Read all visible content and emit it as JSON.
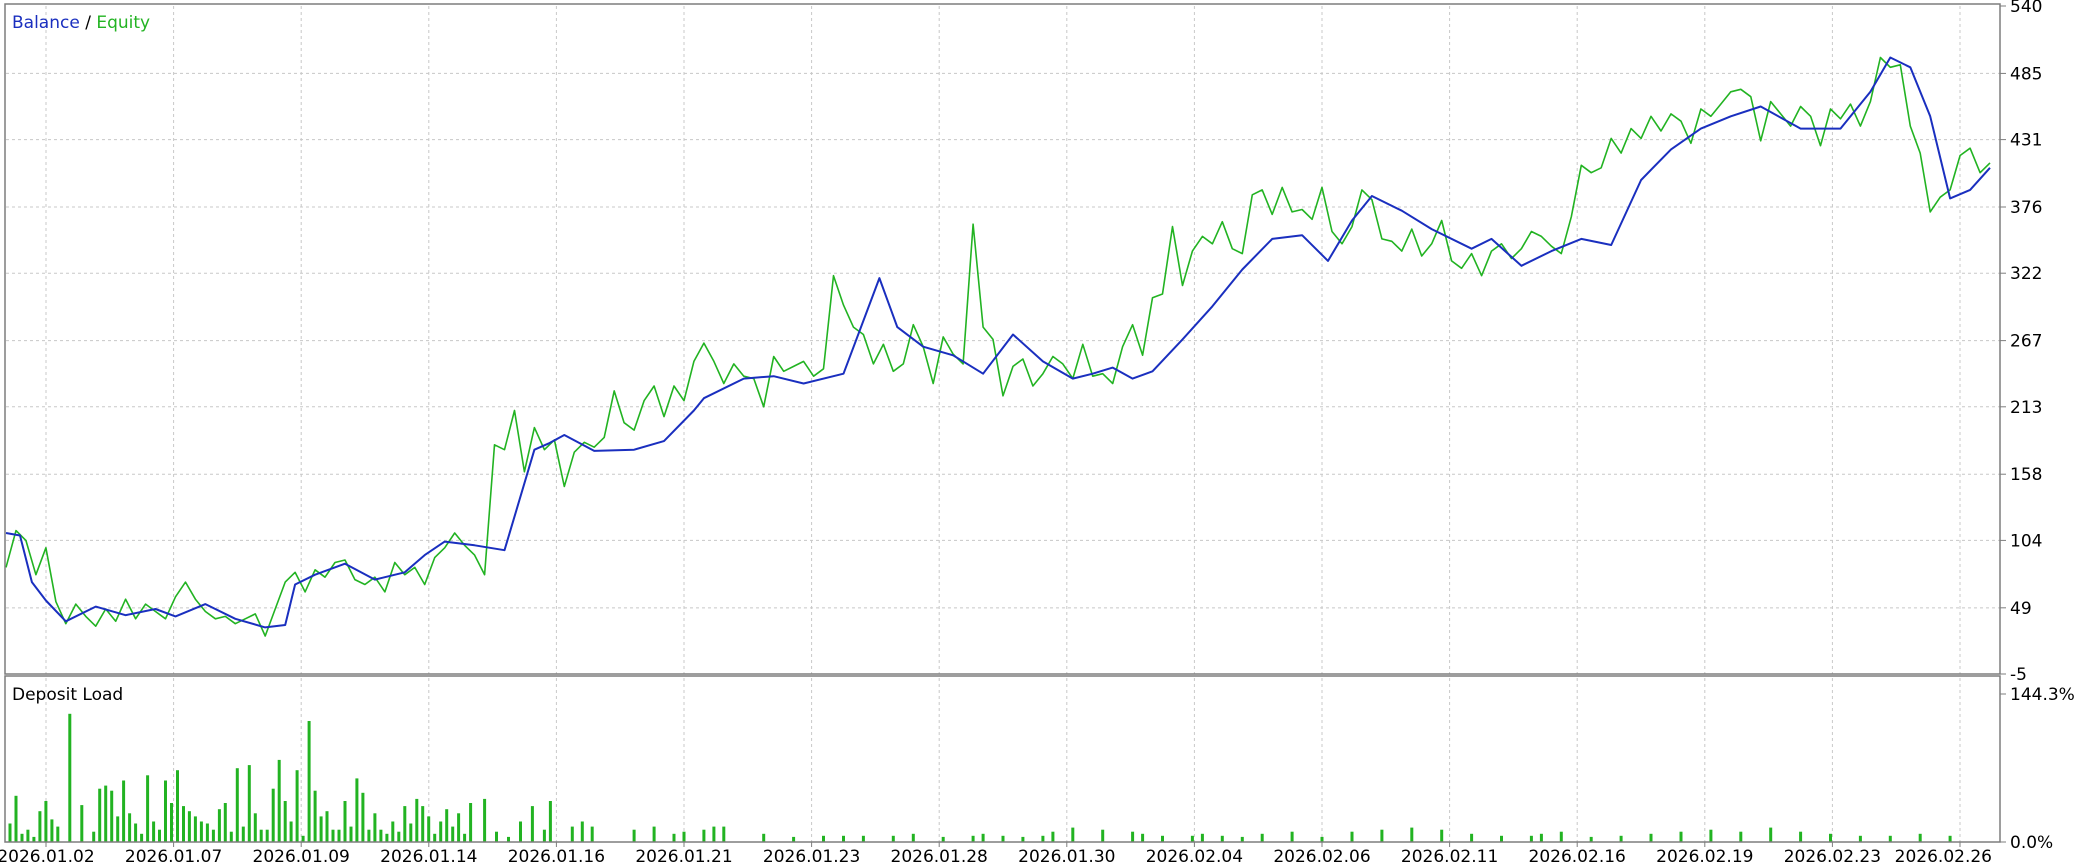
{
  "colors": {
    "balance": "#1a2fbf",
    "equity": "#22b322",
    "grid": "#c8c8c8",
    "frame": "#7d7d7d",
    "text": "#000000",
    "background": "#ffffff",
    "deposit_bars": "#22b322"
  },
  "chart_data": [
    {
      "type": "line",
      "legend": {
        "placement": "top-left",
        "entries": [
          "Balance",
          "Equity"
        ],
        "separator": " / "
      },
      "y_ticks": [
        "540",
        "485",
        "431",
        "376",
        "322",
        "267",
        "213",
        "158",
        "104",
        "49",
        "-5"
      ],
      "ylim": [
        -5,
        540
      ],
      "grid": true,
      "x_tick_labels": [
        "2026.01.02",
        "2026.01.07",
        "2026.01.09",
        "2026.01.14",
        "2026.01.16",
        "2026.01.21",
        "2026.01.23",
        "2026.01.28",
        "2026.01.30",
        "2026.02.04",
        "2026.02.06",
        "2026.02.11",
        "2026.02.16",
        "2026.02.19",
        "2026.02.23",
        "2026.02.26"
      ],
      "x_range": [
        0,
        100
      ],
      "series": [
        {
          "name": "Balance",
          "x": [
            0,
            0.7,
            1.3,
            2,
            3,
            4.5,
            6,
            7.5,
            8.5,
            10,
            11.5,
            13,
            14,
            14.5,
            15.5,
            17,
            18.5,
            20,
            21,
            22,
            23.5,
            25,
            26.5,
            27.2,
            28,
            29.5,
            31.5,
            33,
            34.5,
            35,
            37,
            38.5,
            40,
            42,
            43.8,
            44.7,
            46,
            47.5,
            49,
            50.5,
            52,
            53.5,
            54.5,
            55.5,
            56.5,
            57.5,
            59,
            60.5,
            62,
            63.5,
            65,
            66.3,
            67.5,
            68.5,
            70,
            71.5,
            73.5,
            74.5,
            76,
            77.5,
            79,
            80.5,
            82,
            83.5,
            85,
            86.5,
            88,
            90,
            92,
            93.5,
            94.5,
            95.5,
            96.5,
            97.5,
            98.5,
            99.5
          ],
          "y": [
            110,
            108,
            70,
            55,
            38,
            50,
            43,
            48,
            42,
            52,
            40,
            33,
            35,
            68,
            76,
            85,
            72,
            78,
            92,
            103,
            100,
            96,
            178,
            183,
            190,
            177,
            178,
            185,
            210,
            220,
            236,
            238,
            232,
            240,
            318,
            278,
            262,
            255,
            240,
            272,
            250,
            236,
            240,
            245,
            236,
            242,
            268,
            295,
            325,
            350,
            353,
            332,
            365,
            385,
            373,
            358,
            342,
            350,
            328,
            340,
            350,
            345,
            398,
            423,
            440,
            450,
            458,
            440,
            440,
            470,
            498,
            490,
            450,
            383,
            390,
            408
          ]
        },
        {
          "name": "Equity",
          "x": [
            0,
            0.5,
            1,
            1.5,
            2,
            2.5,
            3,
            3.5,
            4,
            4.5,
            5,
            5.5,
            6,
            6.5,
            7,
            7.5,
            8,
            8.5,
            9,
            9.5,
            10,
            10.5,
            11,
            11.5,
            12,
            12.5,
            13,
            13.5,
            14,
            14.5,
            15,
            15.5,
            16,
            16.5,
            17,
            17.5,
            18,
            18.5,
            19,
            19.5,
            20,
            20.5,
            21,
            21.5,
            22,
            22.5,
            23,
            23.5,
            24,
            24.5,
            25,
            25.5,
            26,
            26.5,
            27,
            27.5,
            28,
            28.5,
            29,
            29.5,
            30,
            30.5,
            31,
            31.5,
            32,
            32.5,
            33,
            33.5,
            34,
            34.5,
            35,
            35.5,
            36,
            36.5,
            37,
            37.5,
            38,
            38.5,
            39,
            39.5,
            40,
            40.5,
            41,
            41.5,
            42,
            42.5,
            43,
            43.5,
            44,
            44.5,
            45,
            45.5,
            46,
            46.5,
            47,
            47.5,
            48,
            48.5,
            49,
            49.5,
            50,
            50.5,
            51,
            51.5,
            52,
            52.5,
            53,
            53.5,
            54,
            54.5,
            55,
            55.5,
            56,
            56.5,
            57,
            57.5,
            58,
            58.5,
            59,
            59.5,
            60,
            60.5,
            61,
            61.5,
            62,
            62.5,
            63,
            63.5,
            64,
            64.5,
            65,
            65.5,
            66,
            66.5,
            67,
            67.5,
            68,
            68.5,
            69,
            69.5,
            70,
            70.5,
            71,
            71.5,
            72,
            72.5,
            73,
            73.5,
            74,
            74.5,
            75,
            75.5,
            76,
            76.5,
            77,
            77.5,
            78,
            78.5,
            79,
            79.5,
            80,
            80.5,
            81,
            81.5,
            82,
            82.5,
            83,
            83.5,
            84,
            84.5,
            85,
            85.5,
            86,
            86.5,
            87,
            87.5,
            88,
            88.5,
            89,
            89.5,
            90,
            90.5,
            91,
            91.5,
            92,
            92.5,
            93,
            93.5,
            94,
            94.5,
            95,
            95.5,
            96,
            96.5,
            97,
            97.5,
            98,
            98.5,
            99,
            99.5
          ],
          "y": [
            82,
            112,
            104,
            76,
            98,
            54,
            36,
            52,
            42,
            34,
            48,
            38,
            56,
            40,
            52,
            46,
            40,
            58,
            70,
            56,
            46,
            40,
            42,
            36,
            40,
            44,
            26,
            48,
            70,
            78,
            62,
            80,
            74,
            86,
            88,
            72,
            68,
            74,
            62,
            86,
            76,
            82,
            68,
            90,
            98,
            110,
            100,
            92,
            76,
            182,
            178,
            210,
            160,
            196,
            178,
            186,
            148,
            176,
            184,
            180,
            188,
            226,
            200,
            194,
            218,
            230,
            205,
            230,
            218,
            250,
            265,
            250,
            232,
            248,
            238,
            236,
            213,
            254,
            242,
            246,
            250,
            238,
            244,
            320,
            296,
            278,
            272,
            248,
            264,
            242,
            248,
            280,
            262,
            232,
            270,
            256,
            248,
            362,
            278,
            268,
            222,
            246,
            252,
            230,
            240,
            254,
            248,
            236,
            264,
            238,
            240,
            232,
            262,
            280,
            255,
            302,
            305,
            360,
            312,
            340,
            352,
            346,
            364,
            342,
            338,
            386,
            390,
            370,
            392,
            372,
            374,
            366,
            392,
            356,
            346,
            360,
            390,
            382,
            350,
            348,
            340,
            358,
            336,
            346,
            365,
            332,
            326,
            338,
            320,
            340,
            346,
            334,
            342,
            356,
            352,
            344,
            338,
            368,
            410,
            404,
            408,
            432,
            420,
            440,
            432,
            450,
            438,
            452,
            446,
            428,
            456,
            450,
            460,
            470,
            472,
            466,
            430,
            462,
            452,
            442,
            458,
            450,
            426,
            456,
            448,
            460,
            442,
            462,
            498,
            490,
            492,
            442,
            420,
            372,
            384,
            390,
            418,
            424,
            404,
            412
          ]
        }
      ]
    },
    {
      "type": "bar",
      "title": "Deposit Load",
      "y_ticks": [
        "144.3%",
        "0.0%"
      ],
      "ylim": [
        0,
        144.3
      ],
      "x_range": [
        0,
        100
      ],
      "x": [
        0.2,
        0.5,
        0.8,
        1.1,
        1.4,
        1.7,
        2.0,
        2.3,
        2.6,
        3.2,
        3.8,
        4.4,
        4.7,
        5.0,
        5.3,
        5.6,
        5.9,
        6.2,
        6.5,
        6.8,
        7.1,
        7.4,
        7.7,
        8.0,
        8.3,
        8.6,
        8.9,
        9.2,
        9.5,
        9.8,
        10.1,
        10.4,
        10.7,
        11.0,
        11.3,
        11.6,
        11.9,
        12.2,
        12.5,
        12.8,
        13.1,
        13.4,
        13.7,
        14.0,
        14.3,
        14.6,
        14.9,
        15.2,
        15.5,
        15.8,
        16.1,
        16.4,
        16.7,
        17.0,
        17.3,
        17.6,
        17.9,
        18.2,
        18.5,
        18.8,
        19.1,
        19.4,
        19.7,
        20.0,
        20.3,
        20.6,
        20.9,
        21.2,
        21.5,
        21.8,
        22.1,
        22.4,
        22.7,
        23.0,
        23.3,
        24.0,
        24.6,
        25.2,
        25.8,
        26.4,
        27.0,
        27.3,
        28.4,
        28.9,
        29.4,
        31.5,
        32.5,
        33.5,
        34.0,
        35.0,
        35.5,
        36.0,
        38.0,
        39.5,
        41.0,
        42.0,
        43.0,
        44.5,
        45.5,
        47.0,
        48.5,
        49.0,
        50.0,
        51.0,
        52.0,
        52.5,
        53.5,
        55.0,
        56.5,
        57.0,
        58.0,
        59.5,
        60.0,
        61.0,
        62.0,
        63.0,
        64.5,
        66.0,
        67.5,
        69.0,
        70.5,
        72.0,
        73.5,
        75.0,
        76.5,
        77.0,
        78.0,
        79.5,
        81.0,
        82.5,
        84.0,
        85.5,
        87.0,
        88.5,
        90.0,
        91.5,
        93.0,
        94.5,
        96.0,
        97.5,
        98.5,
        99.3
      ],
      "values": [
        18,
        45,
        8,
        12,
        5,
        30,
        40,
        22,
        15,
        125,
        36,
        10,
        52,
        55,
        50,
        25,
        60,
        28,
        18,
        8,
        65,
        20,
        12,
        60,
        38,
        70,
        35,
        30,
        25,
        20,
        18,
        12,
        32,
        38,
        10,
        72,
        15,
        75,
        28,
        12,
        12,
        52,
        80,
        40,
        20,
        70,
        6,
        118,
        50,
        25,
        30,
        12,
        12,
        40,
        15,
        62,
        48,
        12,
        28,
        12,
        8,
        20,
        10,
        35,
        18,
        42,
        35,
        25,
        8,
        20,
        32,
        15,
        28,
        8,
        38,
        42,
        10,
        5,
        20,
        35,
        12,
        40,
        15,
        20,
        15,
        12,
        15,
        8,
        10,
        12,
        15,
        15,
        8,
        5,
        6,
        6,
        6,
        6,
        8,
        5,
        6,
        8,
        6,
        5,
        6,
        10,
        14,
        12,
        10,
        8,
        6,
        6,
        8,
        6,
        5,
        8,
        10,
        5,
        10,
        12,
        14,
        12,
        8,
        6,
        6,
        8,
        10,
        5,
        6,
        8,
        10,
        12,
        10,
        14,
        10,
        8,
        6,
        6,
        8,
        6
      ]
    }
  ]
}
